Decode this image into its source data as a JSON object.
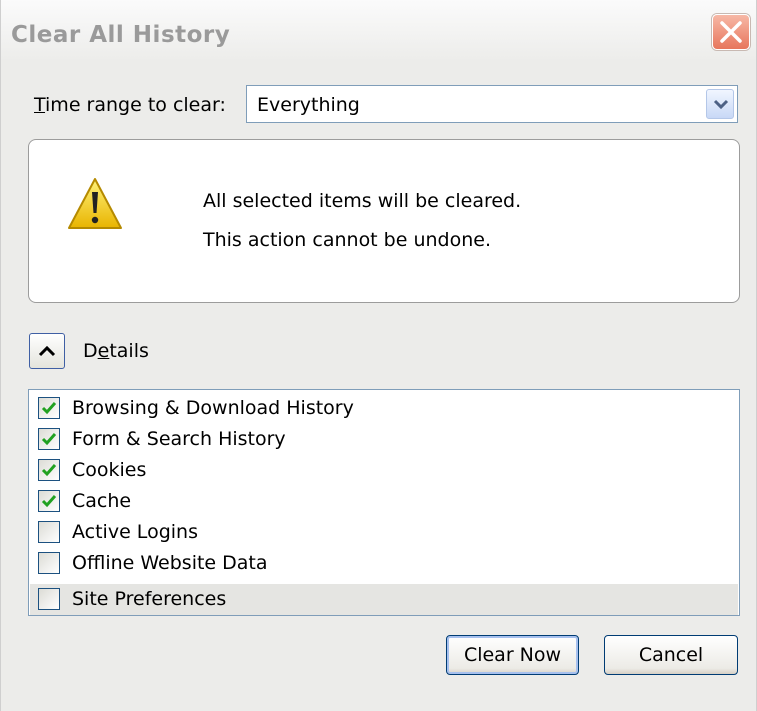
{
  "dialog": {
    "title": "Clear All History"
  },
  "time_range": {
    "label": "Time range to clear:",
    "selected": "Everything"
  },
  "warning": {
    "line1": "All selected items will be cleared.",
    "line2": "This action cannot be undone."
  },
  "details": {
    "label": "Details",
    "expanded": true
  },
  "items": [
    {
      "label": "Browsing & Download History",
      "checked": true
    },
    {
      "label": "Form & Search History",
      "checked": true
    },
    {
      "label": "Cookies",
      "checked": true
    },
    {
      "label": "Cache",
      "checked": true
    },
    {
      "label": "Active Logins",
      "checked": false
    },
    {
      "label": "Offline Website Data",
      "checked": false
    },
    {
      "label": "Site Preferences",
      "checked": false,
      "highlighted": true
    }
  ],
  "buttons": {
    "clear_now": "Clear Now",
    "cancel": "Cancel"
  },
  "colors": {
    "check_mark": "#21a121",
    "warning_yellow": "#f7d21b",
    "close_button": "#e7765c"
  }
}
